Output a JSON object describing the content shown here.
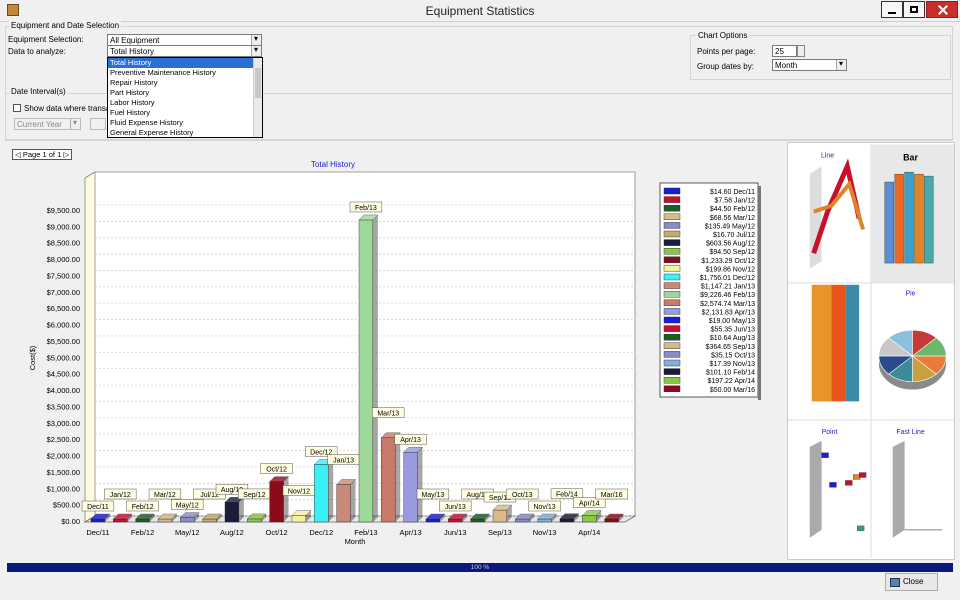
{
  "window": {
    "title": "Equipment Statistics"
  },
  "selection": {
    "group_title": "Equipment and Date Selection",
    "equipment_label": "Equipment Selection:",
    "equipment_value": "All Equipment",
    "data_label": "Data to analyze:",
    "data_value": "Total History",
    "data_options": [
      "Total History",
      "Preventive Maintenance History",
      "Repair History",
      "Part History",
      "Labor History",
      "Fuel History",
      "Fluid Expense History",
      "General Expense History"
    ]
  },
  "date_interval": {
    "group_title": "Date Interval(s)",
    "show_checkbox_label": "Show data where transact",
    "period_value": "Current Year"
  },
  "chart_options": {
    "group_title": "Chart Options",
    "points_label": "Points per page:",
    "points_value": "25",
    "group_label": "Group dates by:",
    "group_value": "Month"
  },
  "pager": {
    "label": "Page 1 of 1"
  },
  "progress": {
    "value_text": "100 %",
    "fraction": 1.0
  },
  "close_button": {
    "label": "Close"
  },
  "chart_data": {
    "type": "bar",
    "title": "Total History",
    "xlabel": "Month",
    "ylabel": "Cost($)",
    "ylim": [
      0,
      9500
    ],
    "yticks": [
      "$0.00",
      "$500.00",
      "$1,000.00",
      "$1,500.00",
      "$2,000.00",
      "$2,500.00",
      "$3,000.00",
      "$3,500.00",
      "$4,000.00",
      "$4,500.00",
      "$5,000.00",
      "$5,500.00",
      "$6,000.00",
      "$6,500.00",
      "$7,000.00",
      "$7,500.00",
      "$8,000.00",
      "$8,500.00",
      "$9,000.00",
      "$9,500.00"
    ],
    "xtick_labels": [
      "Dec/11",
      "Feb/12",
      "May/12",
      "Aug/12",
      "Oct/12",
      "Dec/12",
      "Feb/13",
      "Apr/13",
      "Jun/13",
      "Sep/13",
      "Nov/13",
      "Apr/14"
    ],
    "categories": [
      "Dec/11",
      "Jan/12",
      "Feb/12",
      "Mar/12",
      "May/12",
      "Jul/12",
      "Aug/12",
      "Sep/12",
      "Oct/12",
      "Nov/12",
      "Dec/12",
      "Jan/13",
      "Feb/13",
      "Mar/13",
      "Apr/13",
      "May/13",
      "Jun/13",
      "Aug/13",
      "Sep/13",
      "Oct/13",
      "Nov/13",
      "Feb/14",
      "Apr/14",
      "Mar/16"
    ],
    "values": [
      14.6,
      7.58,
      44.5,
      68.56,
      135.49,
      16.7,
      603.56,
      94.5,
      1233.29,
      199.86,
      1756.01,
      1147.21,
      9226.46,
      2574.74,
      2131.83,
      19.0,
      55.35,
      10.64,
      364.65,
      35.15,
      17.39,
      101.1,
      197.22,
      50.0
    ],
    "colors": [
      "#1c1cd4",
      "#c8102e",
      "#1f5c2a",
      "#d9b98a",
      "#8a8ac8",
      "#c7a96a",
      "#1b1b3a",
      "#8ac84a",
      "#8a0b1a",
      "#f4f29a",
      "#39f0f7",
      "#c9897a",
      "#9ed99a",
      "#c77a6a",
      "#9a9ae0",
      "#1c1cd4",
      "#c8102e",
      "#1f5c2a",
      "#d9b98a",
      "#8a8ac8",
      "#7fb0e0",
      "#1b1b3a",
      "#8ac84a",
      "#8a0b1a"
    ],
    "legend": [
      "$14.60 Dec/11",
      "$7.58 Jan/12",
      "$44.50 Feb/12",
      "$68.56 Mar/12",
      "$135.49 May/12",
      "$16.70 Jul/12",
      "$603.56 Aug/12",
      "$94.50 Sep/12",
      "$1,233.29 Oct/12",
      "$199.86 Nov/12",
      "$1,756.01 Dec/12",
      "$1,147.21 Jan/13",
      "$9,226.46 Feb/13",
      "$2,574.74 Mar/13",
      "$2,131.83 Apr/13",
      "$19.00 May/13",
      "$55.35 Jun/13",
      "$10.64 Aug/13",
      "$364.65 Sep/13",
      "$35.15 Oct/13",
      "$17.39 Nov/13",
      "$101.10 Feb/14",
      "$197.22 Apr/14",
      "$50.00 Mar/16"
    ]
  },
  "thumbnails": {
    "line_label": "Line",
    "bar_label": "Bar",
    "pie_label": "Pie",
    "point_label": "Point",
    "fastline_label": "Fast Line"
  }
}
